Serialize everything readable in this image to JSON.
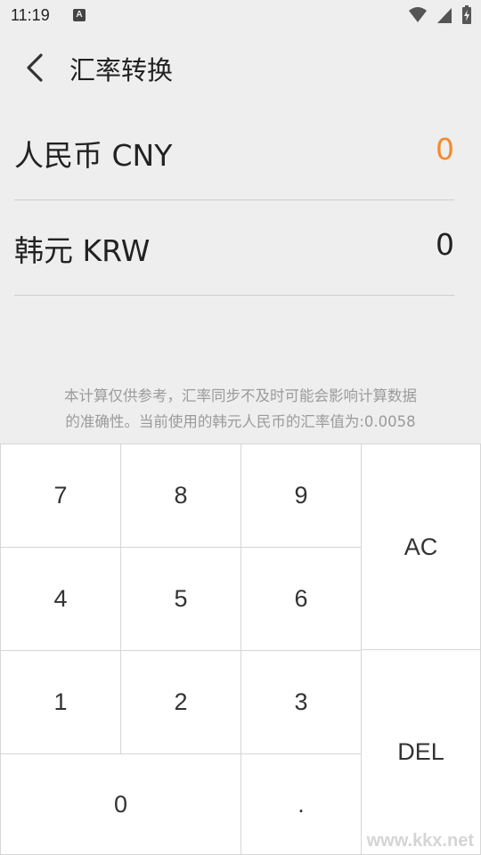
{
  "status": {
    "time": "11:19",
    "notification_icon": "A"
  },
  "header": {
    "title": "汇率转换"
  },
  "currencies": [
    {
      "name": "人民币 CNY",
      "value": "0"
    },
    {
      "name": "韩元 KRW",
      "value": "0"
    }
  ],
  "note": {
    "line1": "本计算仅供参考，汇率同步不及时可能会影响计算数据",
    "line2": "的准确性。当前使用的韩元人民币的汇率值为:0.0058"
  },
  "keypad": {
    "k7": "7",
    "k8": "8",
    "k9": "9",
    "ac": "AC",
    "k4": "4",
    "k5": "5",
    "k6": "6",
    "k1": "1",
    "k2": "2",
    "k3": "3",
    "del": "DEL",
    "k0": "0",
    "dot": "."
  },
  "watermark": "www.kkx.net",
  "colors": {
    "active_value": "#f58a2b",
    "background": "#eeeeee"
  }
}
